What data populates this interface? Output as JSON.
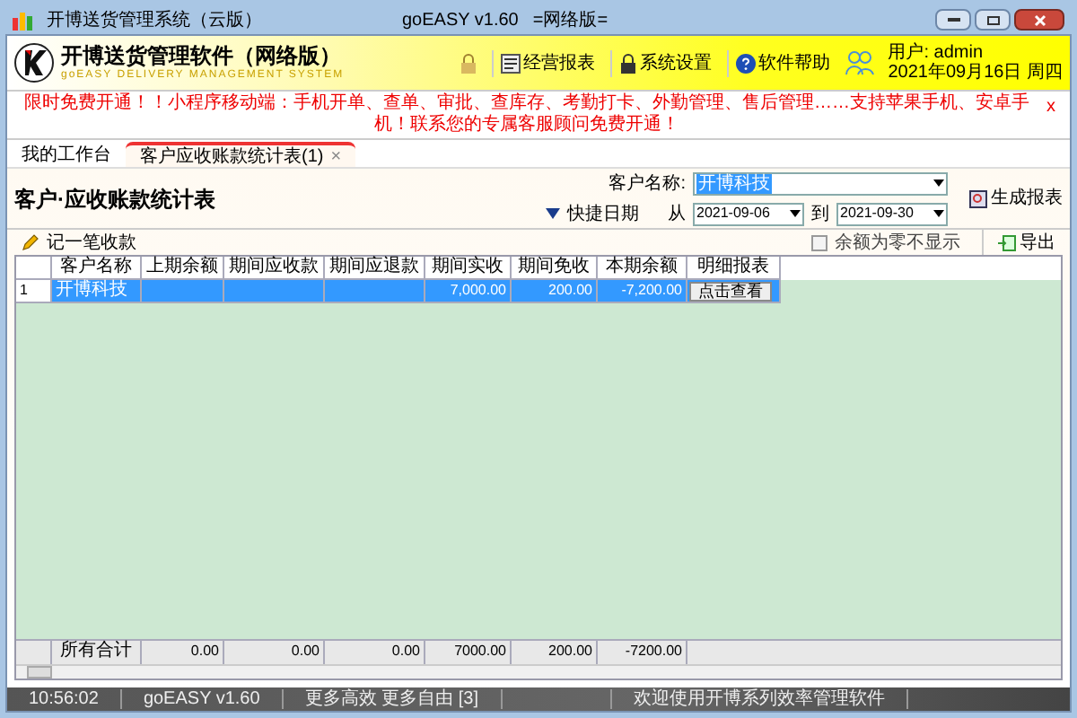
{
  "window": {
    "title": "开博送货管理系统（云版）",
    "version": "goEASY v1.60",
    "edition": "=网络版="
  },
  "header": {
    "app_name": "开博送货管理软件（网络版）",
    "subtitle": "goEASY DELIVERY MANAGEMENT SYSTEM",
    "menu": [
      {
        "label": "经营报表",
        "kind": "report"
      },
      {
        "label": "系统设置",
        "kind": "settings"
      },
      {
        "label": "软件帮助",
        "kind": "help"
      }
    ],
    "user": "用户: admin",
    "date": "2021年09月16日 周四"
  },
  "banner": {
    "text": "限时免费开通！！小程序移动端：手机开单、查单、审批、查库存、考勤打卡、外勤管理、售后管理……支持苹果手机、安卓手机！联系您的专属客服顾问免费开通！",
    "close": "x"
  },
  "tabs": [
    {
      "label": "我的工作台",
      "selected": false
    },
    {
      "label": "客户应收账款统计表(1)",
      "selected": true,
      "close": "×"
    }
  ],
  "report": {
    "title": "客户·应收账款统计表",
    "customer_label": "客户名称:",
    "customer_value": "开博科技",
    "quick_date": "快捷日期",
    "from_label": "从",
    "from": "2021-09-06",
    "to_label": "到",
    "to": "2021-09-30",
    "generate": "生成报表"
  },
  "toolbar": {
    "add": "记一笔收款",
    "hide_zero": {
      "label": "余额为零不显示",
      "checked": false
    },
    "export": "导出"
  },
  "table": {
    "columns": [
      "客户名称",
      "上期余额",
      "期间应收款",
      "期间应退款",
      "期间实收",
      "期间免收",
      "本期余额",
      "明细报表"
    ],
    "rows": [
      {
        "index": "1",
        "cells": [
          "开博科技",
          "",
          "",
          "",
          "7,000.00",
          "200.00",
          "-7,200.00"
        ],
        "action": "点击查看",
        "selected": true
      }
    ],
    "footer": [
      "所有合计",
      "0.00",
      "0.00",
      "0.00",
      "7000.00",
      "200.00",
      "-7200.00"
    ]
  },
  "status_bar": [
    "10:56:02",
    "goEASY v1.60",
    "更多高效 更多自由 [3]",
    "欢迎使用开博系列效率管理软件"
  ]
}
